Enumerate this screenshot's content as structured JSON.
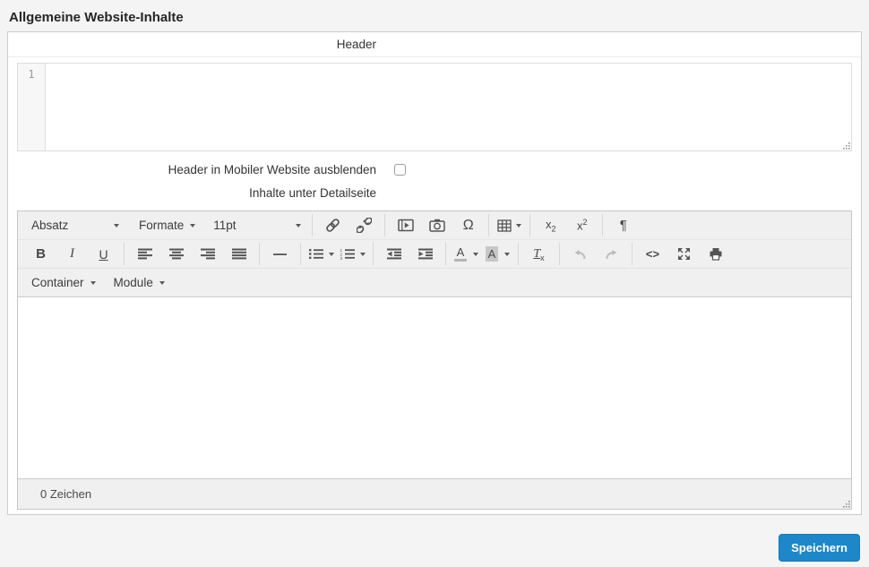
{
  "page": {
    "title": "Allgemeine Website-Inhalte"
  },
  "panel": {
    "header_row": {
      "label": "Header"
    },
    "code_editor": {
      "line_number": "1",
      "content": ""
    },
    "mobile_hide_row": {
      "label": "Header in Mobiler Website ausblenden",
      "checkbox_checked": false
    },
    "detail_row": {
      "label": "Inhalte unter Detailseite"
    },
    "rte": {
      "toolbar_row1": {
        "paragraph_dropdown_label": "Absatz",
        "formats_dropdown_label": "Formate",
        "fontsize_dropdown_label": "11pt",
        "special_char_glyph": "Ω",
        "subscript_base": "x",
        "subscript_small": "2",
        "superscript_base": "x",
        "superscript_small": "2",
        "pilcrow_glyph": "¶",
        "icons": [
          "link-icon",
          "unlink-icon",
          "media-icon",
          "image-icon",
          "special-char-icon",
          "table-icon",
          "subscript-icon",
          "superscript-icon",
          "paragraph-icon"
        ]
      },
      "toolbar_row2": {
        "bold_glyph": "B",
        "italic_glyph": "I",
        "underline_glyph": "U",
        "forecolor_glyph": "A",
        "backcolor_glyph": "A",
        "removeformat_base": "T",
        "removeformat_small": "x",
        "code_glyph": "<>",
        "icons": [
          "bold-icon",
          "italic-icon",
          "underline-icon",
          "align-left-icon",
          "align-center-icon",
          "align-right-icon",
          "align-justify-icon",
          "horizontal-rule-icon",
          "bullet-list-icon",
          "numbered-list-icon",
          "outdent-icon",
          "indent-icon",
          "text-color-icon",
          "background-color-icon",
          "clear-formatting-icon",
          "undo-icon",
          "redo-icon",
          "source-code-icon",
          "fullscreen-icon",
          "print-icon"
        ]
      },
      "toolbar_row3": {
        "container_dropdown_label": "Container",
        "module_dropdown_label": "Module"
      },
      "content": "",
      "statusbar": {
        "char_count": "0 Zeichen"
      }
    }
  },
  "footer": {
    "save_button_label": "Speichern"
  },
  "colors": {
    "accent": "#1d87c9",
    "toolbar_bg": "#f0f0f0",
    "panel_border": "#cccccc",
    "page_bg": "#f4f4f4",
    "icon_color": "#555555",
    "disabled_icon_color": "#bcbcbc"
  }
}
